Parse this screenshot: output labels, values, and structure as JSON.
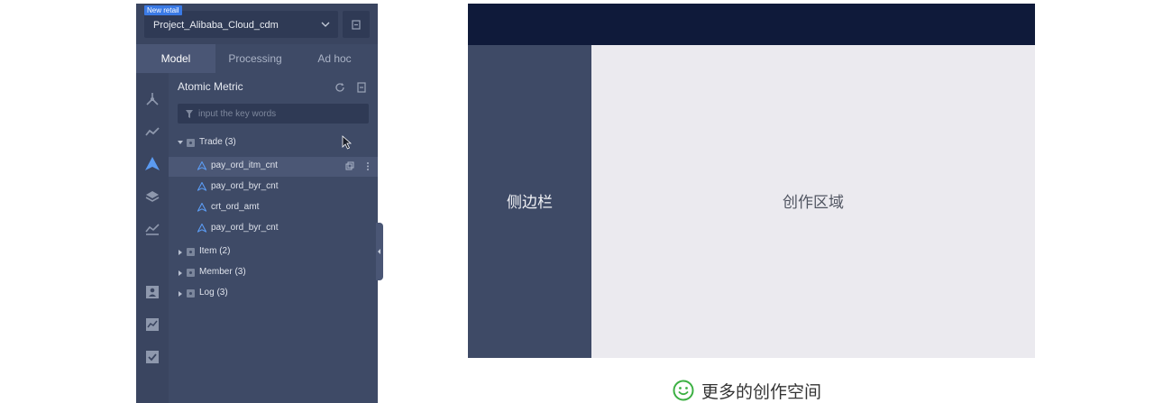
{
  "project": {
    "tag": "New retail",
    "name": "Project_Alibaba_Cloud_cdm"
  },
  "tabs": [
    {
      "label": "Model",
      "active": true
    },
    {
      "label": "Processing",
      "active": false
    },
    {
      "label": "Ad hoc",
      "active": false
    }
  ],
  "rail_icons": [
    "network-icon",
    "trend-icon",
    "atomic-metric-icon",
    "layers-icon",
    "chart-icon",
    "user-report-icon",
    "dashboard-icon",
    "checklist-icon"
  ],
  "section": {
    "title": "Atomic Metric",
    "refresh_icon": "refresh-icon",
    "export_icon": "file-export-icon"
  },
  "search": {
    "placeholder": "input the key words"
  },
  "tree": {
    "trade": {
      "label": "Trade (3)",
      "items": [
        {
          "label": "pay_ord_itm_cnt",
          "selected": true
        },
        {
          "label": "pay_ord_byr_cnt",
          "selected": false
        },
        {
          "label": "crt_ord_amt",
          "selected": false
        },
        {
          "label": "pay_ord_byr_cnt",
          "selected": false
        }
      ]
    },
    "item": {
      "label": "Item (2)"
    },
    "member": {
      "label": "Member (3)"
    },
    "log": {
      "label": "Log (3)"
    }
  },
  "diagram": {
    "sidebar_label": "侧边栏",
    "main_label": "创作区域"
  },
  "caption": "更多的创作空间",
  "colors": {
    "panel_bg": "#3e4a66",
    "accent_blue": "#3a7ae6",
    "topbar_navy": "#0f1a3a",
    "main_area": "#ebeaef",
    "smile_green": "#3cb043"
  }
}
